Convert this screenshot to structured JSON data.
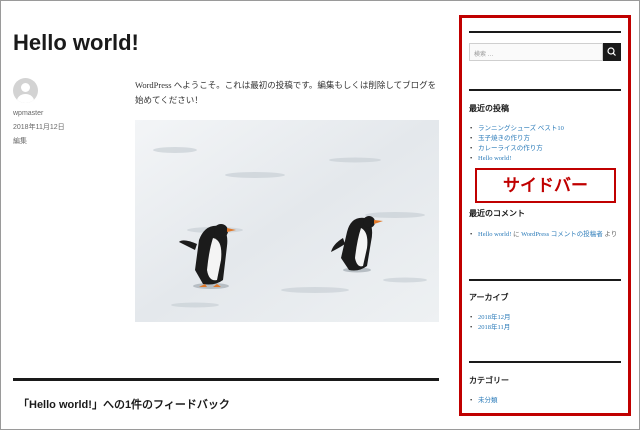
{
  "post": {
    "title": "Hello world!",
    "author": "wpmaster",
    "date": "2018年11月12日",
    "edit_label": "編集",
    "content": "WordPress へようこそ。これは最初の投稿です。編集もしくは削除してブログを始めてください！",
    "image_alt": "penguins"
  },
  "comments": {
    "title": "「Hello world!」への1件のフィードバック"
  },
  "sidebar": {
    "search_placeholder": "検索 …",
    "recent_posts_title": "最近の投稿",
    "recent_posts": [
      "ランニングシューズ ベスト10",
      "玉子焼きの作り方",
      "カレーライスの作り方",
      "Hello world!"
    ],
    "recent_comments_title": "最近のコメント",
    "recent_comment": {
      "post_link": "Hello world!",
      "on_text": " に ",
      "author_link": "WordPress コメントの投稿者",
      "suffix": " より"
    },
    "archives_title": "アーカイブ",
    "archives": [
      "2018年12月",
      "2018年11月"
    ],
    "categories_title": "カテゴリー",
    "categories": [
      "未分類"
    ]
  },
  "annotation": {
    "label": "サイドバー",
    "color": "#c00000"
  },
  "colors": {
    "link": "#2b7bb9",
    "text": "#1a1a1a"
  }
}
